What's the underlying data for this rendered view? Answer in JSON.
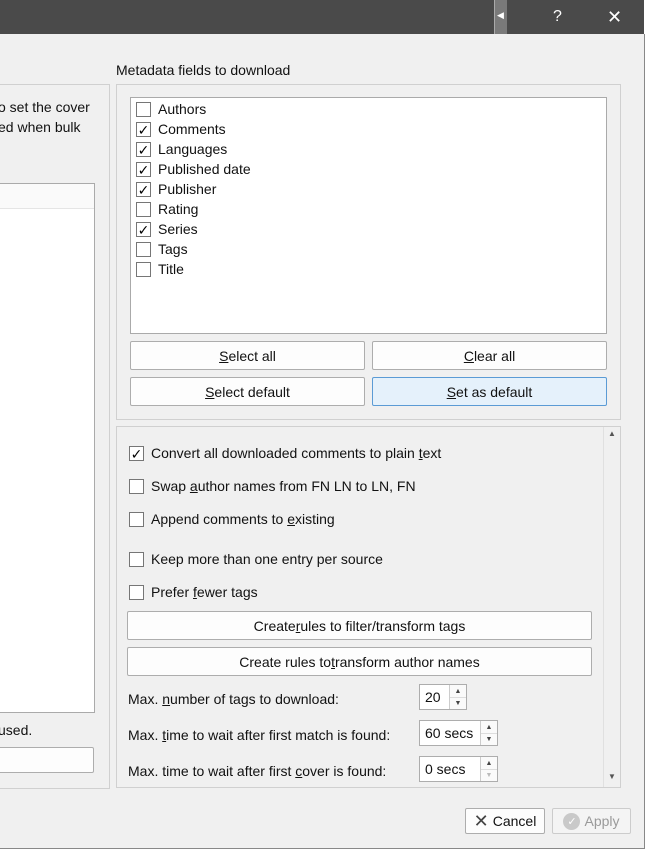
{
  "titlebar": {
    "help_label": "?",
    "close_label": "✕"
  },
  "left": {
    "desc_line1": "o set the cover",
    "desc_line2": "ed when bulk",
    "bottom_text": "used."
  },
  "metadata": {
    "heading": "Metadata fields to download",
    "fields": [
      {
        "label": "Authors",
        "checked": false
      },
      {
        "label": "Comments",
        "checked": true
      },
      {
        "label": "Languages",
        "checked": true
      },
      {
        "label": "Published date",
        "checked": true
      },
      {
        "label": "Publisher",
        "checked": true
      },
      {
        "label": "Rating",
        "checked": false
      },
      {
        "label": "Series",
        "checked": true
      },
      {
        "label": "Tags",
        "checked": false
      },
      {
        "label": "Title",
        "checked": false
      }
    ],
    "select_all": {
      "pre": "",
      "ul": "S",
      "post": "elect all"
    },
    "clear_all": {
      "pre": "",
      "ul": "C",
      "post": "lear all"
    },
    "select_default": {
      "pre": "",
      "ul": "S",
      "post": "elect default"
    },
    "set_as_default": {
      "pre": "",
      "ul": "S",
      "post": "et as default"
    }
  },
  "options": {
    "convert_comments": {
      "pre": "Convert all downloaded comments to plain ",
      "ul": "t",
      "post": "ext",
      "checked": true
    },
    "swap_author": {
      "pre": "Swap ",
      "ul": "a",
      "post": "uthor names from FN LN to LN, FN",
      "checked": false
    },
    "append_comments": {
      "pre": "Append comments to ",
      "ul": "e",
      "post": "xisting",
      "checked": false
    },
    "keep_more": {
      "pre": "Keep more than one entry per source",
      "ul": "",
      "post": "",
      "checked": false
    },
    "prefer_fewer": {
      "pre": "Prefer ",
      "ul": "f",
      "post": "ewer tags",
      "checked": false
    },
    "rules_tags": {
      "pre": "Create ",
      "ul": "r",
      "post": "ules to filter/transform tags"
    },
    "rules_authors": {
      "pre": "Create rules to ",
      "ul": "t",
      "post": "ransform author names"
    },
    "max_tags": {
      "pre": "Max. ",
      "ul": "n",
      "post": "umber of tags to download:",
      "value": "20"
    },
    "max_wait_match": {
      "pre": "Max. ",
      "ul": "t",
      "post": "ime to wait after first match is found:",
      "value": "60 secs"
    },
    "max_wait_cover": {
      "pre": "Max. time to wait after first ",
      "ul": "c",
      "post": "over is found:",
      "value": "0 secs"
    }
  },
  "footer": {
    "cancel_label": "Cancel",
    "apply_label": "Apply"
  },
  "colors": {
    "titlebar": "#4a4a4a",
    "dialog_bg": "#f0f0f0",
    "focus_border": "#5b9bd5"
  }
}
